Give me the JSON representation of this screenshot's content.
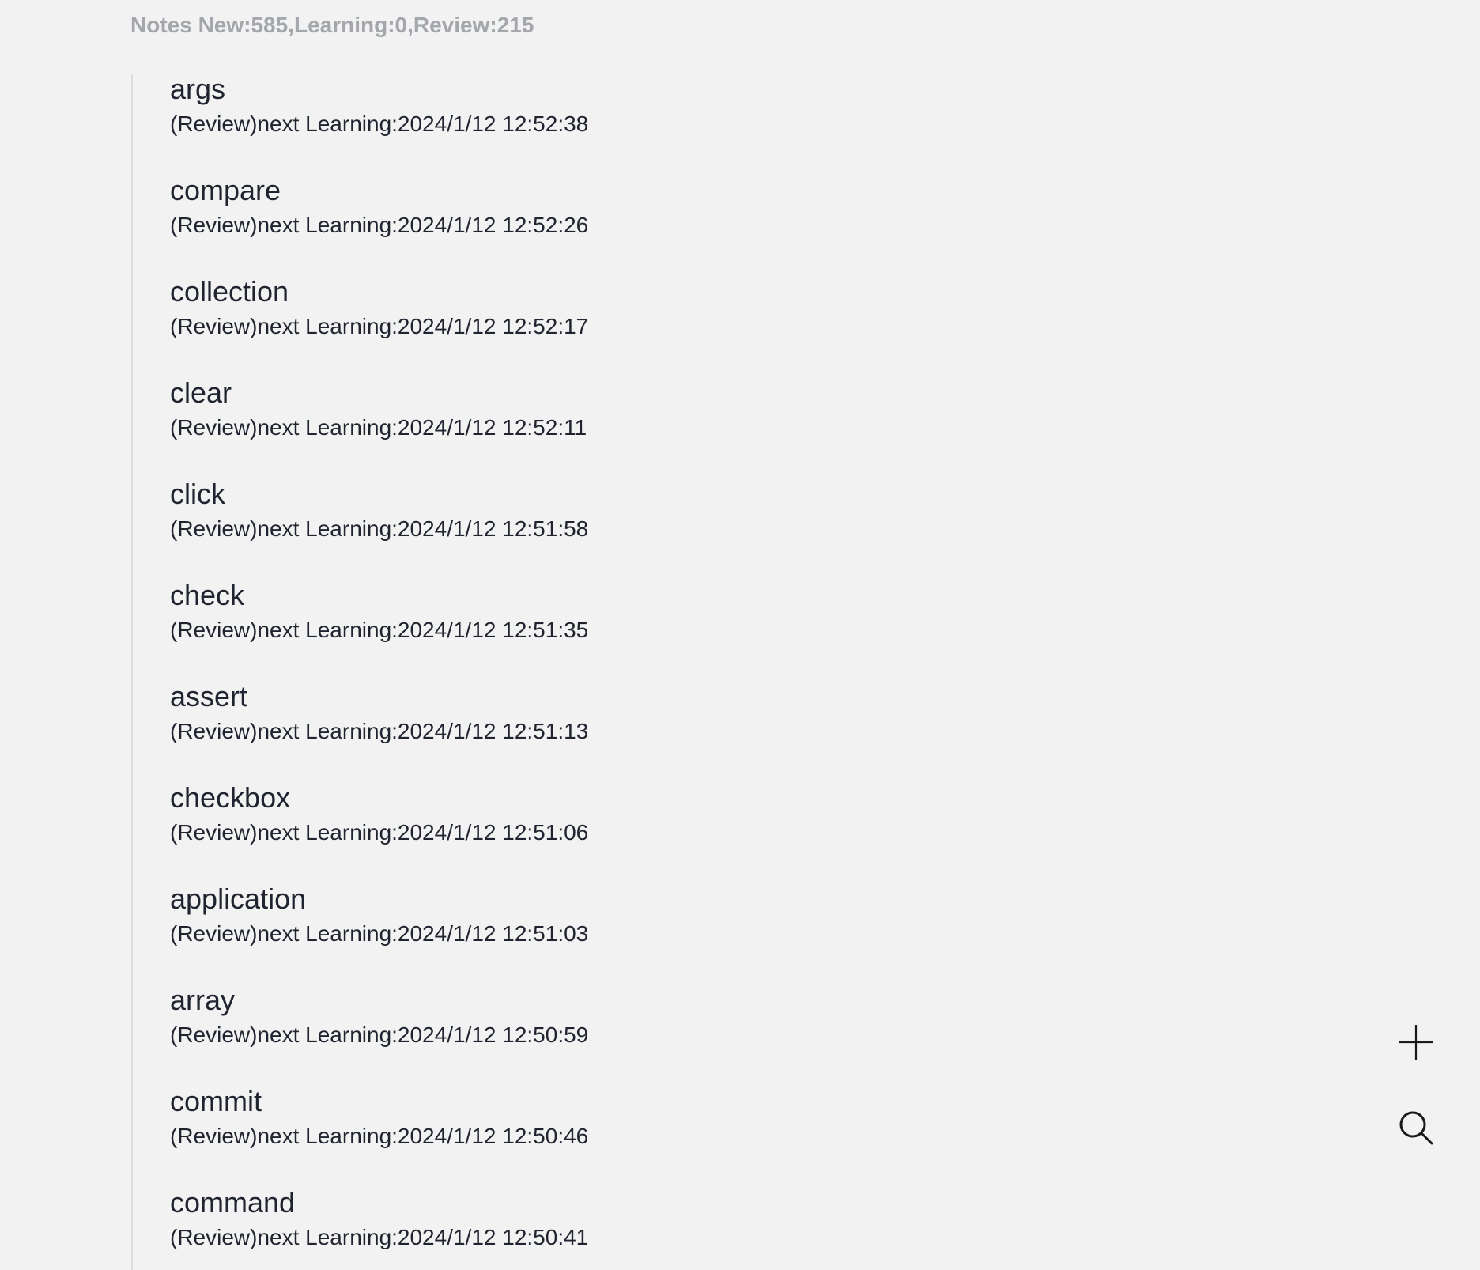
{
  "header": {
    "stats": "Notes New:585,Learning:0,Review:215"
  },
  "notes": [
    {
      "title": "args",
      "info": "(Review)next Learning:2024/1/12 12:52:38"
    },
    {
      "title": "compare",
      "info": "(Review)next Learning:2024/1/12 12:52:26"
    },
    {
      "title": "collection",
      "info": "(Review)next Learning:2024/1/12 12:52:17"
    },
    {
      "title": "clear",
      "info": "(Review)next Learning:2024/1/12 12:52:11"
    },
    {
      "title": "click",
      "info": "(Review)next Learning:2024/1/12 12:51:58"
    },
    {
      "title": "check",
      "info": "(Review)next Learning:2024/1/12 12:51:35"
    },
    {
      "title": "assert",
      "info": "(Review)next Learning:2024/1/12 12:51:13"
    },
    {
      "title": "checkbox",
      "info": "(Review)next Learning:2024/1/12 12:51:06"
    },
    {
      "title": "application",
      "info": "(Review)next Learning:2024/1/12 12:51:03"
    },
    {
      "title": "array",
      "info": "(Review)next Learning:2024/1/12 12:50:59"
    },
    {
      "title": "commit",
      "info": "(Review)next Learning:2024/1/12 12:50:46"
    },
    {
      "title": "command",
      "info": "(Review)next Learning:2024/1/12 12:50:41"
    }
  ],
  "actions": {
    "add_icon": "plus-icon",
    "search_icon": "search-icon"
  }
}
